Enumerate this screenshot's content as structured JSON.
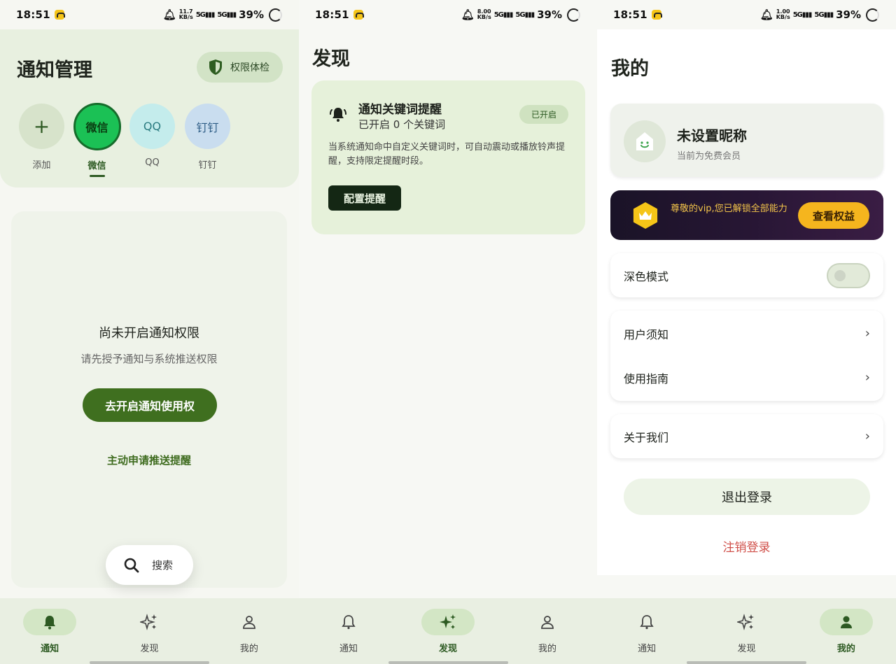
{
  "status_bars": [
    {
      "time": "18:51",
      "speed": "11.7",
      "speed_unit": "KB/s",
      "battery": "39%"
    },
    {
      "time": "18:51",
      "speed": "8.00",
      "speed_unit": "KB/s",
      "battery": "39%"
    },
    {
      "time": "18:51",
      "speed": "1.00",
      "speed_unit": "KB/s",
      "battery": "39%"
    }
  ],
  "signal": "5G",
  "notify_page": {
    "title": "通知管理",
    "perm_button": "权限体检",
    "apps": [
      {
        "icon_text": "+",
        "label": "添加"
      },
      {
        "icon_text": "微信",
        "label": "微信"
      },
      {
        "icon_text": "QQ",
        "label": "QQ"
      },
      {
        "icon_text": "钉钉",
        "label": "钉钉"
      }
    ],
    "empty_title": "尚未开启通知权限",
    "empty_sub": "请先授予通知与系统推送权限",
    "open_button": "去开启通知使用权",
    "apply_link": "主动申请推送提醒",
    "search_label": "搜索"
  },
  "discover_page": {
    "title": "发现",
    "card_title": "通知关键词提醒",
    "card_sub": "已开启 0 个关键词",
    "badge": "已开启",
    "desc": "当系统通知命中自定义关键词时，可自动震动或播放铃声提醒，支持限定提醒时段。",
    "config_button": "配置提醒"
  },
  "me_page": {
    "title": "我的",
    "nickname": "未设置昵称",
    "member": "当前为免费会员",
    "vip_text": "尊敬的vip,您已解锁全部能力",
    "vip_button": "查看权益",
    "dark_mode": "深色模式",
    "dark_mode_on": false,
    "user_notice": "用户须知",
    "guide": "使用指南",
    "about": "关于我们",
    "logout": "退出登录",
    "cancel_account": "注销登录"
  },
  "nav": {
    "notify": "通知",
    "discover": "发现",
    "me": "我的"
  },
  "colors": {
    "accent": "#3f6f1f",
    "wechat": "#1bc155",
    "vip_gold": "#f5b51e",
    "danger": "#d0504a"
  }
}
